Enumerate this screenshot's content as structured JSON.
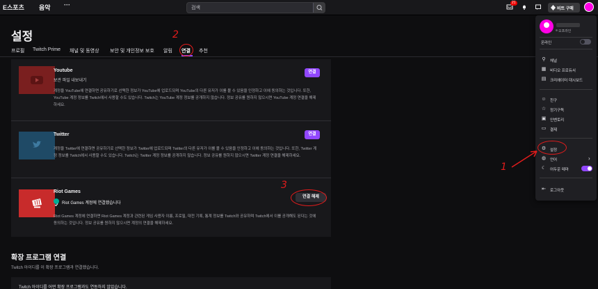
{
  "topbar": {
    "nav": [
      "E스포츠",
      "음악"
    ],
    "more": "···",
    "search_value": "검색",
    "notification_count": "21",
    "buy_label": "비트 구매"
  },
  "page": {
    "title": "설정",
    "tabs": [
      "프로필",
      "Twitch Prime",
      "채널 및 동영상",
      "보안 및 개인정보 보호",
      "알림",
      "연결",
      "추천"
    ],
    "active_tab": "연결"
  },
  "connections": [
    {
      "name": "Youtube",
      "subtitle": "보관 파일 내보내기",
      "description": "계정을 YouTube에 연결하면 공유하기로 선택한 정보가 YouTube에 업로드되며 YouTube의 다른 유저가 이를 볼 수 있음을 인정하고 이에 동의하는 것입니다. 또한, YouTube 계정 정보를 Twitch에서 사용할 수도 있습니다. Twitch는 YouTube 계정 정보를 공개하지 않습니다. 정보 공유를 원하지 않으시면 YouTube 계정 연결을 해제하세요.",
      "button": "연결",
      "color": "#7a1f1f"
    },
    {
      "name": "Twitter",
      "subtitle": "",
      "description": "계정을 Twitter에 연결하면 공유하기로 선택한 정보가 Twitter에 업로드되며 Twitter의 다른 유저가 이를 볼 수 있음을 인정하고 이에 동의하는 것입니다. 또한, Twitter 계정 정보를 Twitch에서 사용할 수도 있습니다. Twitch는 Twitter 계정 정보를 공개하지 않습니다. 정보 공유를 원하지 않으시면 Twitter 계정 연결을 해제하세요.",
      "button": "연결",
      "color": "#1f4a66"
    },
    {
      "name": "Riot Games",
      "status": "Riot Games 계정에 연결했습니다",
      "description": "Riot Games 계정에 연결하면 Riot Games 계정과 관련된 게임 사용자 이름, 프로필, 대전 기록, 통계 정보를 Twitch와 공유하며 Twitch에서 이를 공개해도 된다는 것에 동의하는 것입니다. 정보 공유를 원하지 않으시면 계정의 연결을 해제하세요.",
      "button": "연결 해제",
      "color": "#c82b2b"
    }
  ],
  "extensions": {
    "title": "확장 프로그램 연결",
    "subtitle": "Twitch 아이디를 이 확장 프로그램과 연결했습니다.",
    "empty": "Twitch 아이디를 어떤 확장 프로그램과도 연동하지 않았습니다."
  },
  "menu": {
    "status": "오프라인",
    "online_label": "온라인",
    "items_a": [
      "채널",
      "비디오 프로듀서",
      "크리에이터 대시보드"
    ],
    "items_b": [
      "친구",
      "정기구독",
      "인벤토리",
      "결제"
    ],
    "items_c": [
      "설정",
      "언어",
      "어두운 테마"
    ],
    "logout": "로그아웃"
  },
  "annotations": [
    "1",
    "2",
    "3"
  ],
  "colors": {
    "accent": "#9147ff",
    "annotation": "#e31c1c",
    "background": "#0e0e10"
  }
}
